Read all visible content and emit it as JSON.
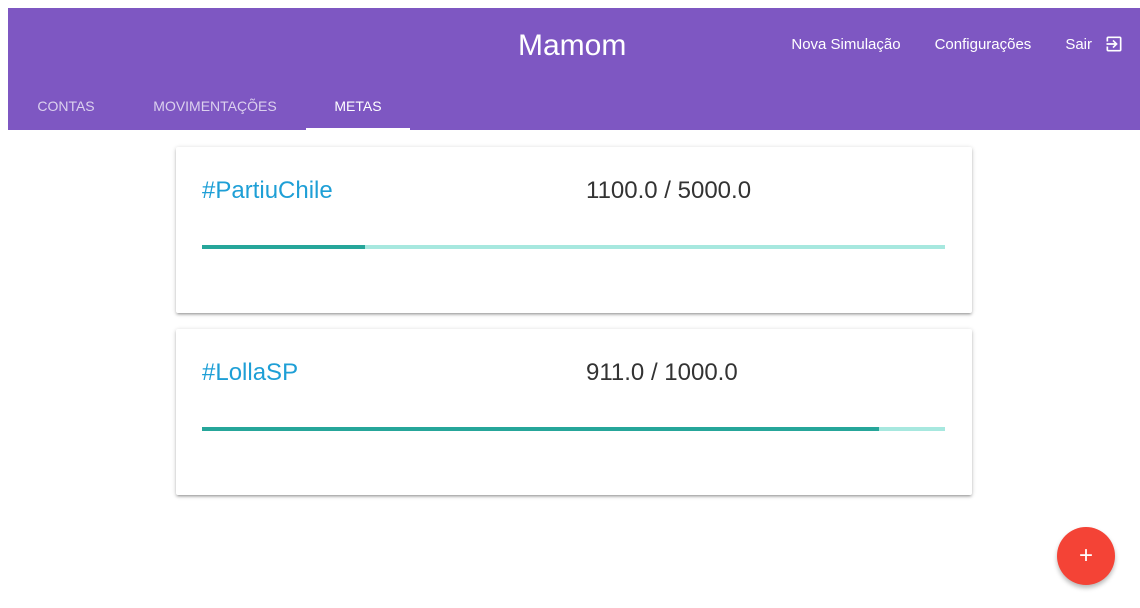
{
  "app": {
    "title": "Mamom"
  },
  "nav": {
    "nova_simulacao": "Nova Simulação",
    "configuracoes": "Configurações",
    "sair": "Sair",
    "exit_icon": "exit-to-app-icon"
  },
  "tabs": [
    {
      "label": "CONTAS",
      "active": false
    },
    {
      "label": "MOVIMENTAÇÕES",
      "active": false
    },
    {
      "label": "METAS",
      "active": true
    }
  ],
  "goals": [
    {
      "name": "#PartiuChile",
      "current": 1100.0,
      "target": 5000.0,
      "amount_text": "1100.0 / 5000.0",
      "progress": 0.22
    },
    {
      "name": "#LollaSP",
      "current": 911.0,
      "target": 1000.0,
      "amount_text": "911.0 / 1000.0",
      "progress": 0.911
    }
  ],
  "fab": {
    "label": "+",
    "icon": "add-icon"
  },
  "colors": {
    "primary": "#7e57c2",
    "accent": "#f44336",
    "link": "#1e9fd6",
    "progress_fill": "#26a69a",
    "progress_track": "#a7e8df"
  }
}
